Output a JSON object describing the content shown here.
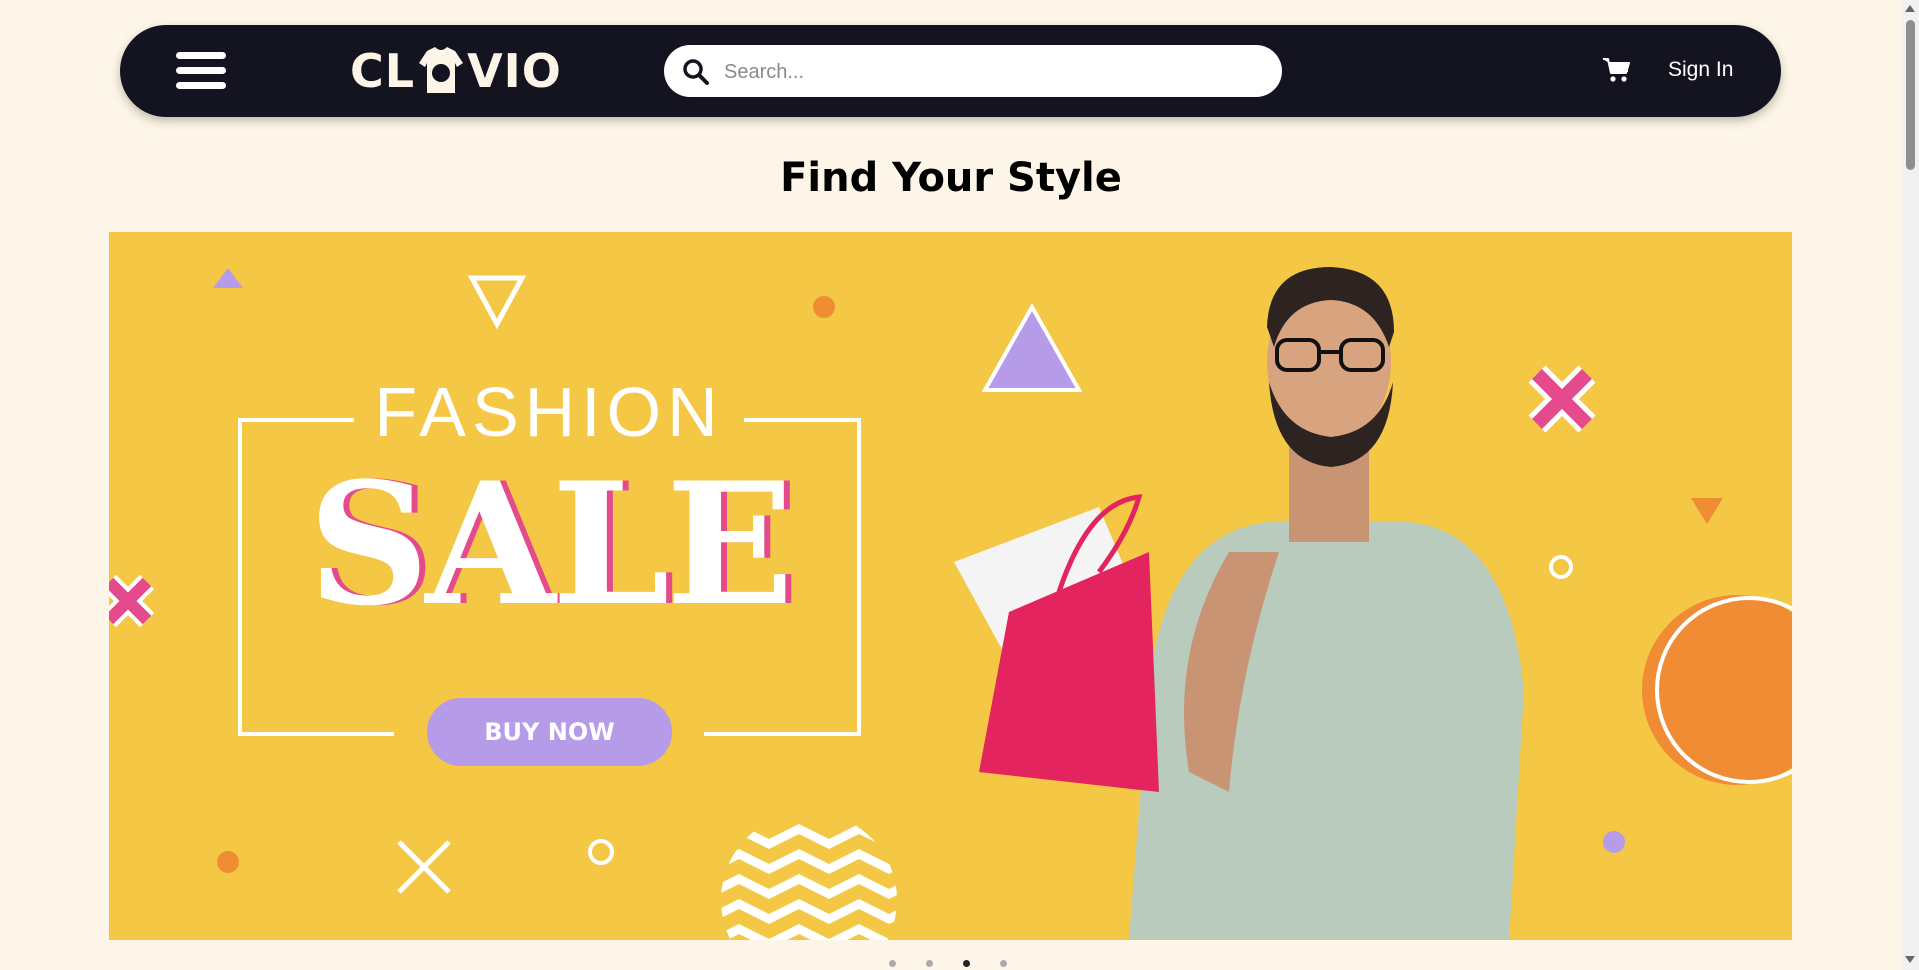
{
  "header": {
    "logo_text_left": "CL",
    "logo_text_right": "VIO",
    "search_placeholder": "Search...",
    "sign_in_label": "Sign In"
  },
  "main": {
    "heading": "Find Your Style"
  },
  "banner": {
    "top_word": "FASHION",
    "main_word": "SALE",
    "cta_label": "BUY NOW"
  },
  "carousel": {
    "slide_count": 4,
    "active_slide": 3
  },
  "colors": {
    "page_background": "#fdf6e8",
    "navbar": "#141420",
    "banner_background": "#f4c744",
    "accent_pink": "#e44a8c",
    "accent_purple": "#b59be8",
    "accent_orange": "#f08c34"
  },
  "icons": {
    "menu": "hamburger-icon",
    "search": "search-icon",
    "cart": "cart-icon"
  }
}
